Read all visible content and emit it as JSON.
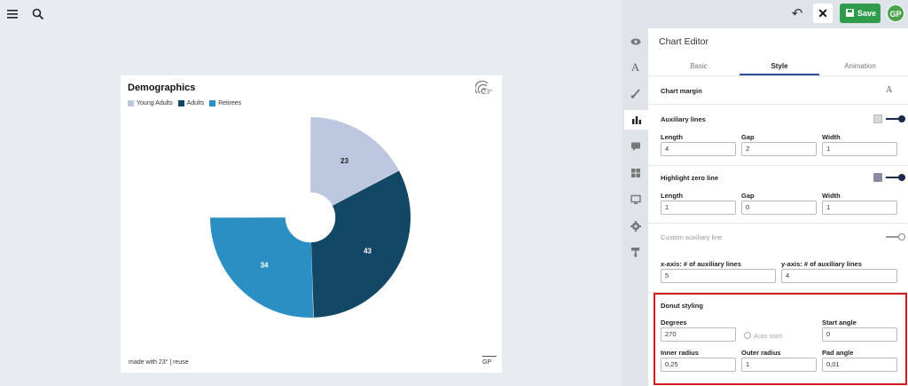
{
  "toolbar": {
    "menu_icon": "hamburger-icon",
    "search_icon": "search-icon",
    "undo_icon": "undo-icon",
    "close_label": "✕",
    "save_label": "Save",
    "avatar_initials": "GP"
  },
  "editor": {
    "title": "Chart Editor",
    "tabs": [
      {
        "label": "Basic",
        "active": false
      },
      {
        "label": "Style",
        "active": true
      },
      {
        "label": "Animation",
        "active": false
      }
    ],
    "strip_icons": [
      "eye-icon",
      "text-icon",
      "brush-icon",
      "bar-chart-icon",
      "comment-icon",
      "grid-icon",
      "screen-icon",
      "gear-icon",
      "paint-roller-icon"
    ],
    "chart_margin": {
      "label": "Chart margin",
      "icon": "A"
    },
    "auxiliary_lines": {
      "label": "Auxiliary lines",
      "swatch_color": "#d9d9d9",
      "enabled": true,
      "length_label": "Length",
      "length_value": "4",
      "gap_label": "Gap",
      "gap_value": "2",
      "width_label": "Width",
      "width_value": "1"
    },
    "highlight_zero_line": {
      "label": "Highlight zero line",
      "swatch_color": "#8a8aa0",
      "enabled": true,
      "length_label": "Length",
      "length_value": "1",
      "gap_label": "Gap",
      "gap_value": "0",
      "width_label": "Width",
      "width_value": "1"
    },
    "custom_auxiliary_line": {
      "label": "Custom auxiliary line",
      "enabled": false
    },
    "x_axis_aux": {
      "label": "x-axis: # of auxiliary lines",
      "value": "5"
    },
    "y_axis_aux": {
      "label": "y-axis: # of auxiliary lines",
      "value": "4"
    },
    "donut_styling": {
      "label": "Donut styling",
      "degrees_label": "Degrees",
      "degrees_value": "270",
      "auto_start_label": "Auto start",
      "start_angle_label": "Start angle",
      "start_angle_value": "0",
      "inner_radius_label": "Inner radius",
      "inner_radius_value": "0,25",
      "outer_radius_label": "Outer radius",
      "outer_radius_value": "1",
      "pad_angle_label": "Pad angle",
      "pad_angle_value": "0,01"
    }
  },
  "chart_card": {
    "title": "Demographics",
    "logo_text": "23°",
    "footer_left": "made with 23° | reuse",
    "footer_right": "GP"
  },
  "chart_data": {
    "type": "pie",
    "title": "Demographics",
    "categories": [
      "Young Adults",
      "Adults",
      "Retirees"
    ],
    "values": [
      23,
      43,
      34
    ],
    "colors": [
      "#bdc8e0",
      "#134766",
      "#2b8fc4"
    ],
    "label_colors": [
      "#222222",
      "#ffffff",
      "#ffffff"
    ],
    "degrees": 270,
    "start_angle": 0,
    "inner_radius": 0.25,
    "outer_radius": 1,
    "pad_angle": 0.01,
    "legend": "top-left"
  }
}
